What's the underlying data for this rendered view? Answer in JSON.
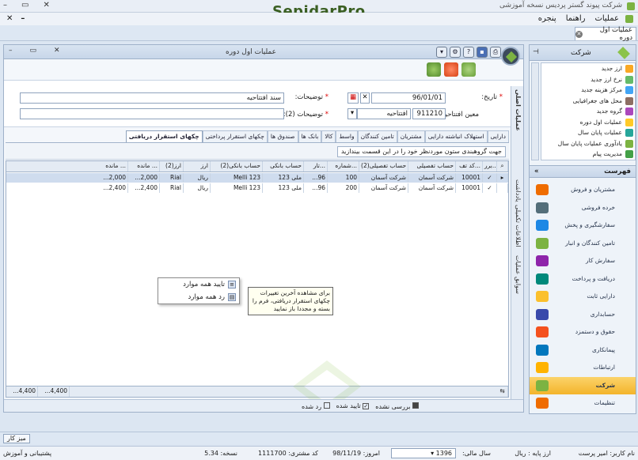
{
  "app": {
    "title": "شرکت پیوند گستر پردیس نسخه آموزشی",
    "brand_main": "Sepidar",
    "brand_sub": "Pro",
    "menus": [
      "عملیات",
      "راهنما",
      "پنجره"
    ],
    "doc_tab": "عملیات اول دوره"
  },
  "window": {
    "title": "عملیات اول دوره",
    "date_label": "تاریخ:",
    "date_value": "96/01/01",
    "desc_label": "توضیحات:",
    "desc_value": "سند افتتاحیه",
    "desc2_label": "توضیحات (2):",
    "desc2_value": "",
    "open_label": "معین افتتاحیه:",
    "open_code": "911210",
    "open_name": "افتتاحیه",
    "side_tabs": [
      "عملیات اصلی",
      "اطلاعات تکمیلی",
      "سوابق عملیات"
    ],
    "side_tab_short": "یادداشت"
  },
  "tabs": [
    "دارایی",
    "استهلاک انباشته دارایی",
    "مشتریان",
    "تامین کنندگان",
    "واسط",
    "کالا",
    "بانک ها",
    "صندوق ها",
    "چکهای استقرار پرداختی",
    "چکهای استقرار دریافتی"
  ],
  "group_hint": "جهت گروهبندی ستون موردنظر خود را در این قسمت بیندازید",
  "grid": {
    "columns": [
      "برر...",
      "کد تف...",
      "حساب تفصیلی",
      "حساب تفصیلی(2)",
      "شماره...",
      "تار...",
      "حساب بانکی",
      "حساب بانکی(2)",
      "ارز",
      "ارز(2)",
      "مانده ...",
      "مانده ..."
    ],
    "rows": [
      [
        "✓",
        "10001",
        "شرکت آسمان",
        "شرکت آسمان",
        "100",
        "...96",
        "ملی 123",
        "Melli 123",
        "ریال",
        "Rial",
        "...2,000",
        "...2,000"
      ],
      [
        "✓",
        "10001",
        "شرکت آسمان",
        "شرکت آسمان",
        "200",
        "...96",
        "ملی 123",
        "Melli 123",
        "ریال",
        "Rial",
        "...2,400",
        "...2,400"
      ]
    ],
    "footer_a": "...4,400",
    "footer_b": "...4,400"
  },
  "context_menu": [
    "تایید همه موارد",
    "رد همه موارد"
  ],
  "tooltip": "برای مشاهده آخرین تغییرات چکهای استقرار دریافتی، فرم را بسته و مجددا باز نمایید",
  "filters": [
    "بررسی نشده",
    "تایید شده",
    "رد شده"
  ],
  "right_panel": {
    "title": "شرکت",
    "items": [
      "ارز جدید",
      "نرخ ارز جدید",
      "مرکز هزینه جدید",
      "محل های جغرافیایی",
      "گروه جدید",
      "عملیات اول دوره",
      "عملیات پایان سال",
      "یادآوری عملیات پایان سال",
      "مدیریت پیام"
    ],
    "menu_title": "فهرست",
    "menu": [
      "مشتریان و فروش",
      "خرده فروشی",
      "سفارشگیری و پخش",
      "تامین کنندگان و انبار",
      "سفارش کار",
      "دریافت و پرداخت",
      "دارایی ثابت",
      "حسابداری",
      "حقوق و دستمزد",
      "پیمانکاری",
      "ارتباطات",
      "شرکت",
      "تنظیمات"
    ],
    "active_menu": "شرکت"
  },
  "taskbar": {
    "button": "میز کار"
  },
  "status": {
    "user": "نام کاربر: امیر پرست",
    "base": "ارز پایه : ریال",
    "fiscal": "سال مالی:",
    "fiscal_value": "1396",
    "today": "امروز: 98/11/19",
    "customer": "کد مشتری: 1111700",
    "version": "نسخه: 5.34",
    "support": "پشتیبانی و آموزش"
  }
}
